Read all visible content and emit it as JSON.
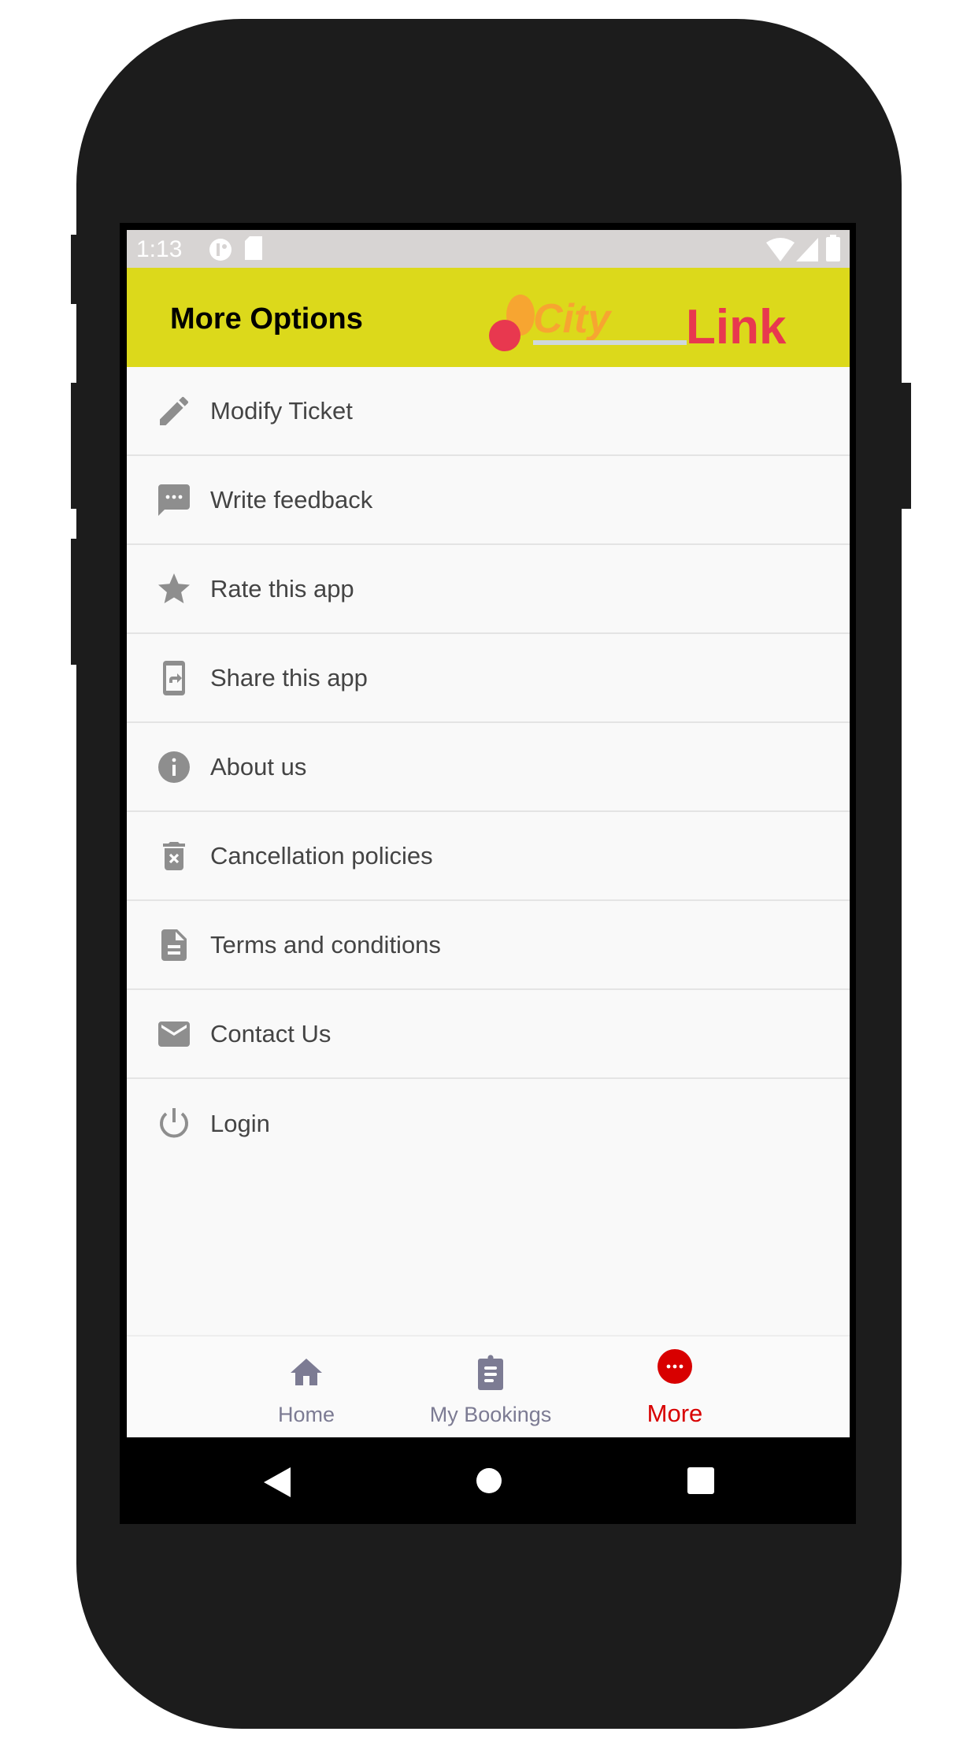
{
  "status_bar": {
    "time": "1:13"
  },
  "header": {
    "title": "More Options",
    "logo_text": "CityLink"
  },
  "menu": [
    {
      "label": "Modify Ticket",
      "icon": "pencil-icon"
    },
    {
      "label": "Write feedback",
      "icon": "feedback-icon"
    },
    {
      "label": "Rate this app",
      "icon": "star-icon"
    },
    {
      "label": "Share this app",
      "icon": "share-phone-icon"
    },
    {
      "label": "About us",
      "icon": "info-icon"
    },
    {
      "label": "Cancellation policies",
      "icon": "delete-icon"
    },
    {
      "label": "Terms and conditions",
      "icon": "document-icon"
    },
    {
      "label": "Contact Us",
      "icon": "mail-icon"
    },
    {
      "label": "Login",
      "icon": "power-icon"
    }
  ],
  "bottom_nav": [
    {
      "label": "Home",
      "icon": "home-icon"
    },
    {
      "label": "My Bookings",
      "icon": "clipboard-icon"
    },
    {
      "label": "More",
      "icon": "more-icon",
      "active": true
    }
  ],
  "colors": {
    "header": "#dcd91b",
    "active": "#d80000",
    "inactive": "#7c7b93"
  }
}
